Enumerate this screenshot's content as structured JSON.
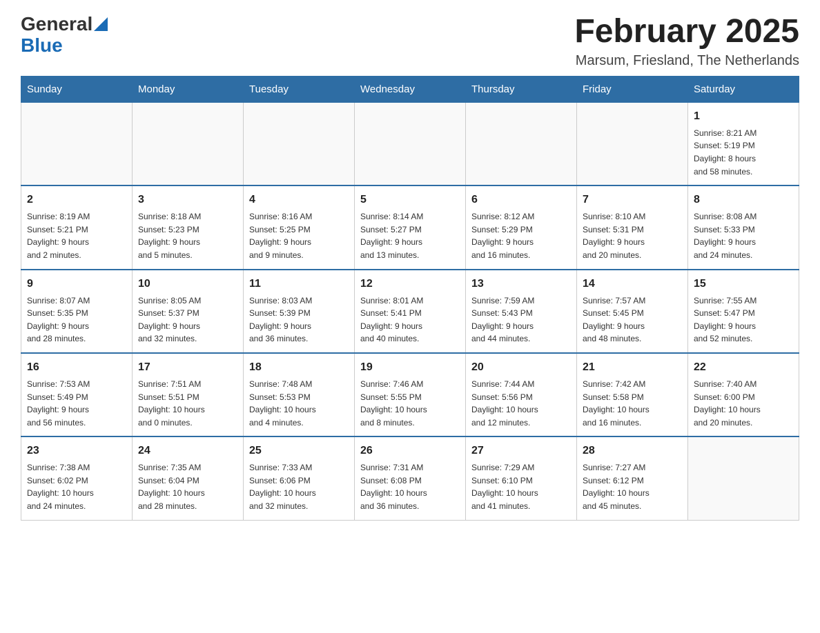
{
  "header": {
    "logo_general": "General",
    "logo_blue": "Blue",
    "month_title": "February 2025",
    "location": "Marsum, Friesland, The Netherlands"
  },
  "days_of_week": [
    "Sunday",
    "Monday",
    "Tuesday",
    "Wednesday",
    "Thursday",
    "Friday",
    "Saturday"
  ],
  "weeks": [
    [
      {
        "day": "",
        "info": ""
      },
      {
        "day": "",
        "info": ""
      },
      {
        "day": "",
        "info": ""
      },
      {
        "day": "",
        "info": ""
      },
      {
        "day": "",
        "info": ""
      },
      {
        "day": "",
        "info": ""
      },
      {
        "day": "1",
        "info": "Sunrise: 8:21 AM\nSunset: 5:19 PM\nDaylight: 8 hours\nand 58 minutes."
      }
    ],
    [
      {
        "day": "2",
        "info": "Sunrise: 8:19 AM\nSunset: 5:21 PM\nDaylight: 9 hours\nand 2 minutes."
      },
      {
        "day": "3",
        "info": "Sunrise: 8:18 AM\nSunset: 5:23 PM\nDaylight: 9 hours\nand 5 minutes."
      },
      {
        "day": "4",
        "info": "Sunrise: 8:16 AM\nSunset: 5:25 PM\nDaylight: 9 hours\nand 9 minutes."
      },
      {
        "day": "5",
        "info": "Sunrise: 8:14 AM\nSunset: 5:27 PM\nDaylight: 9 hours\nand 13 minutes."
      },
      {
        "day": "6",
        "info": "Sunrise: 8:12 AM\nSunset: 5:29 PM\nDaylight: 9 hours\nand 16 minutes."
      },
      {
        "day": "7",
        "info": "Sunrise: 8:10 AM\nSunset: 5:31 PM\nDaylight: 9 hours\nand 20 minutes."
      },
      {
        "day": "8",
        "info": "Sunrise: 8:08 AM\nSunset: 5:33 PM\nDaylight: 9 hours\nand 24 minutes."
      }
    ],
    [
      {
        "day": "9",
        "info": "Sunrise: 8:07 AM\nSunset: 5:35 PM\nDaylight: 9 hours\nand 28 minutes."
      },
      {
        "day": "10",
        "info": "Sunrise: 8:05 AM\nSunset: 5:37 PM\nDaylight: 9 hours\nand 32 minutes."
      },
      {
        "day": "11",
        "info": "Sunrise: 8:03 AM\nSunset: 5:39 PM\nDaylight: 9 hours\nand 36 minutes."
      },
      {
        "day": "12",
        "info": "Sunrise: 8:01 AM\nSunset: 5:41 PM\nDaylight: 9 hours\nand 40 minutes."
      },
      {
        "day": "13",
        "info": "Sunrise: 7:59 AM\nSunset: 5:43 PM\nDaylight: 9 hours\nand 44 minutes."
      },
      {
        "day": "14",
        "info": "Sunrise: 7:57 AM\nSunset: 5:45 PM\nDaylight: 9 hours\nand 48 minutes."
      },
      {
        "day": "15",
        "info": "Sunrise: 7:55 AM\nSunset: 5:47 PM\nDaylight: 9 hours\nand 52 minutes."
      }
    ],
    [
      {
        "day": "16",
        "info": "Sunrise: 7:53 AM\nSunset: 5:49 PM\nDaylight: 9 hours\nand 56 minutes."
      },
      {
        "day": "17",
        "info": "Sunrise: 7:51 AM\nSunset: 5:51 PM\nDaylight: 10 hours\nand 0 minutes."
      },
      {
        "day": "18",
        "info": "Sunrise: 7:48 AM\nSunset: 5:53 PM\nDaylight: 10 hours\nand 4 minutes."
      },
      {
        "day": "19",
        "info": "Sunrise: 7:46 AM\nSunset: 5:55 PM\nDaylight: 10 hours\nand 8 minutes."
      },
      {
        "day": "20",
        "info": "Sunrise: 7:44 AM\nSunset: 5:56 PM\nDaylight: 10 hours\nand 12 minutes."
      },
      {
        "day": "21",
        "info": "Sunrise: 7:42 AM\nSunset: 5:58 PM\nDaylight: 10 hours\nand 16 minutes."
      },
      {
        "day": "22",
        "info": "Sunrise: 7:40 AM\nSunset: 6:00 PM\nDaylight: 10 hours\nand 20 minutes."
      }
    ],
    [
      {
        "day": "23",
        "info": "Sunrise: 7:38 AM\nSunset: 6:02 PM\nDaylight: 10 hours\nand 24 minutes."
      },
      {
        "day": "24",
        "info": "Sunrise: 7:35 AM\nSunset: 6:04 PM\nDaylight: 10 hours\nand 28 minutes."
      },
      {
        "day": "25",
        "info": "Sunrise: 7:33 AM\nSunset: 6:06 PM\nDaylight: 10 hours\nand 32 minutes."
      },
      {
        "day": "26",
        "info": "Sunrise: 7:31 AM\nSunset: 6:08 PM\nDaylight: 10 hours\nand 36 minutes."
      },
      {
        "day": "27",
        "info": "Sunrise: 7:29 AM\nSunset: 6:10 PM\nDaylight: 10 hours\nand 41 minutes."
      },
      {
        "day": "28",
        "info": "Sunrise: 7:27 AM\nSunset: 6:12 PM\nDaylight: 10 hours\nand 45 minutes."
      },
      {
        "day": "",
        "info": ""
      }
    ]
  ]
}
